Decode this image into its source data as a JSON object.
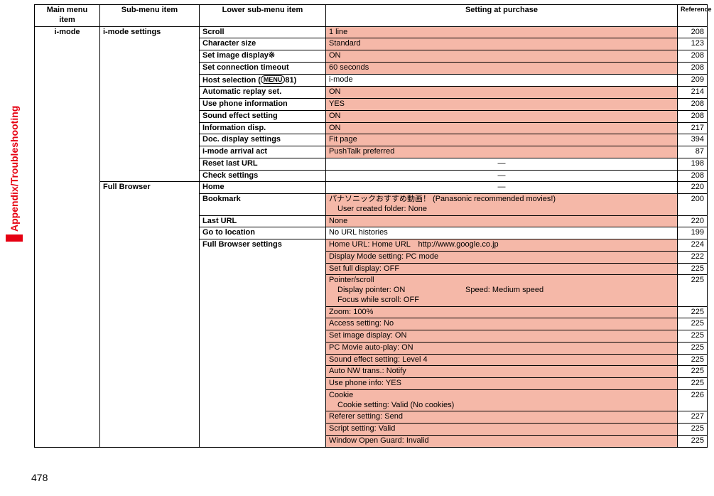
{
  "side_label": "Appendix/Troubleshooting",
  "page_number": "478",
  "headers": {
    "main": "Main menu item",
    "sub": "Sub-menu item",
    "lower": "Lower sub-menu item",
    "setting": "Setting at purchase",
    "ref": "Reference"
  },
  "main_item": "i-mode",
  "sub1": "i-mode settings",
  "sub2": "Full Browser",
  "rows_imode": [
    {
      "lower": "Scroll",
      "setting": "1 line",
      "ref": "208",
      "sal": true
    },
    {
      "lower": "Character size",
      "setting": "Standard",
      "ref": "123",
      "sal": true
    },
    {
      "lower": "Set image display※",
      "setting": "ON",
      "ref": "208",
      "sal": true
    },
    {
      "lower": "Set connection timeout",
      "setting": "60 seconds",
      "ref": "208",
      "sal": true
    },
    {
      "lower_pre": "Host selection (",
      "lower_circ": "MENU",
      "lower_post": "81)",
      "setting": "i-mode",
      "ref": "209",
      "sal": false
    },
    {
      "lower": "Automatic replay set.",
      "setting": "ON",
      "ref": "214",
      "sal": true
    },
    {
      "lower": "Use phone information",
      "setting": "YES",
      "ref": "208",
      "sal": true
    },
    {
      "lower": "Sound effect setting",
      "setting": "ON",
      "ref": "208",
      "sal": true
    },
    {
      "lower": "Information disp.",
      "setting": "ON",
      "ref": "217",
      "sal": true
    },
    {
      "lower": "Doc. display settings",
      "setting": "Fit page",
      "ref": "394",
      "sal": true
    },
    {
      "lower": "i-mode arrival act",
      "setting": "PushTalk preferred",
      "ref": "87",
      "sal": true
    },
    {
      "lower": "Reset last URL",
      "setting": "―",
      "ref": "198",
      "sal": false,
      "center": true
    },
    {
      "lower": "Check settings",
      "setting": "―",
      "ref": "208",
      "sal": false,
      "center": true
    }
  ],
  "rows_fb_top": [
    {
      "lower": "Home",
      "setting": "―",
      "ref": "220",
      "sal": false,
      "center": true
    },
    {
      "lower": "Bookmark",
      "setting_l1": "パナソニックおすすめ動画！ (Panasonic recommended movies!)",
      "setting_l2": "User created folder: None",
      "ref": "200",
      "sal": true
    },
    {
      "lower": "Last URL",
      "setting": "None",
      "ref": "220",
      "sal": true
    },
    {
      "lower": "Go to location",
      "setting": "No URL histories",
      "ref": "199",
      "sal": false
    }
  ],
  "fb_settings_label": "Full Browser settings",
  "fb_settings": [
    {
      "setting": "Home URL: Home URL　http://www.google.co.jp",
      "ref": "224"
    },
    {
      "setting": "Display Mode setting: PC mode",
      "ref": "222"
    },
    {
      "setting": "Set full display: OFF",
      "ref": "225"
    },
    {
      "setting_l1": "Pointer/scroll",
      "setting_l2a": "Display pointer: ON",
      "setting_l2b": "Speed: Medium speed",
      "setting_l2c": "Focus while scroll: OFF",
      "ref": "225"
    },
    {
      "setting": "Zoom: 100%",
      "ref": "225"
    },
    {
      "setting": "Access setting: No",
      "ref": "225"
    },
    {
      "setting": "Set image display: ON",
      "ref": "225"
    },
    {
      "setting": "PC Movie auto-play: ON",
      "ref": "225"
    },
    {
      "setting": "Sound effect setting: Level 4",
      "ref": "225"
    },
    {
      "setting": "Auto NW trans.: Notify",
      "ref": "225"
    },
    {
      "setting": "Use phone info: YES",
      "ref": "225"
    },
    {
      "setting_l1": "Cookie",
      "setting_l2": "Cookie setting: Valid (No cookies)",
      "ref": "226"
    },
    {
      "setting": "Referer setting: Send",
      "ref": "227"
    },
    {
      "setting": "Script setting: Valid",
      "ref": "225"
    },
    {
      "setting": "Window Open Guard: Invalid",
      "ref": "225"
    }
  ]
}
